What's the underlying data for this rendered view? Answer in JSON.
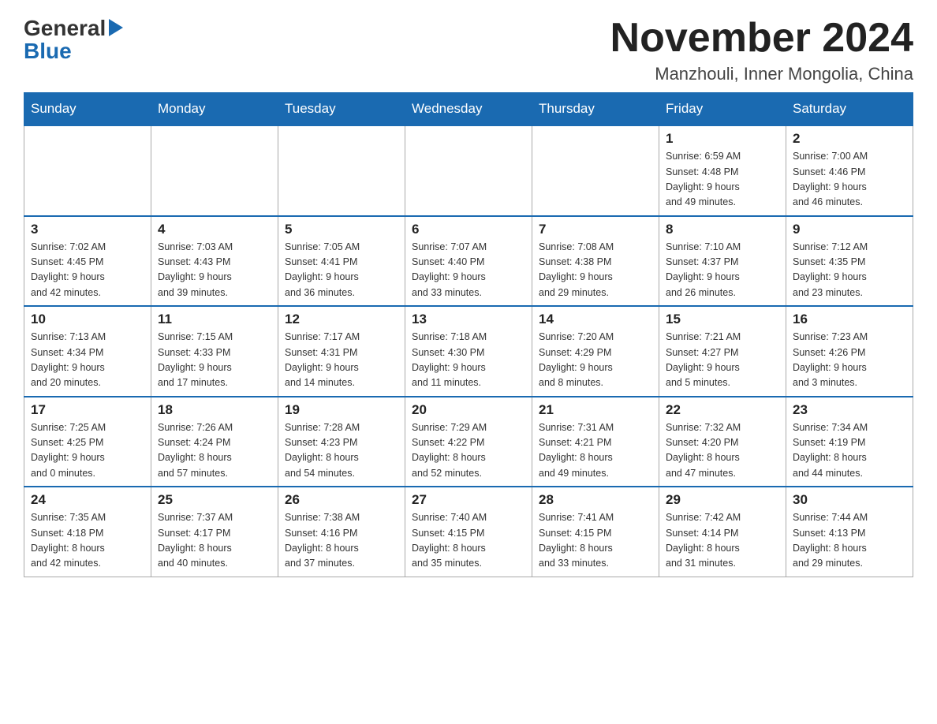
{
  "header": {
    "logo_general": "General",
    "logo_blue": "Blue",
    "month_title": "November 2024",
    "location": "Manzhouli, Inner Mongolia, China"
  },
  "weekdays": [
    "Sunday",
    "Monday",
    "Tuesday",
    "Wednesday",
    "Thursday",
    "Friday",
    "Saturday"
  ],
  "weeks": [
    [
      {
        "day": "",
        "info": ""
      },
      {
        "day": "",
        "info": ""
      },
      {
        "day": "",
        "info": ""
      },
      {
        "day": "",
        "info": ""
      },
      {
        "day": "",
        "info": ""
      },
      {
        "day": "1",
        "info": "Sunrise: 6:59 AM\nSunset: 4:48 PM\nDaylight: 9 hours\nand 49 minutes."
      },
      {
        "day": "2",
        "info": "Sunrise: 7:00 AM\nSunset: 4:46 PM\nDaylight: 9 hours\nand 46 minutes."
      }
    ],
    [
      {
        "day": "3",
        "info": "Sunrise: 7:02 AM\nSunset: 4:45 PM\nDaylight: 9 hours\nand 42 minutes."
      },
      {
        "day": "4",
        "info": "Sunrise: 7:03 AM\nSunset: 4:43 PM\nDaylight: 9 hours\nand 39 minutes."
      },
      {
        "day": "5",
        "info": "Sunrise: 7:05 AM\nSunset: 4:41 PM\nDaylight: 9 hours\nand 36 minutes."
      },
      {
        "day": "6",
        "info": "Sunrise: 7:07 AM\nSunset: 4:40 PM\nDaylight: 9 hours\nand 33 minutes."
      },
      {
        "day": "7",
        "info": "Sunrise: 7:08 AM\nSunset: 4:38 PM\nDaylight: 9 hours\nand 29 minutes."
      },
      {
        "day": "8",
        "info": "Sunrise: 7:10 AM\nSunset: 4:37 PM\nDaylight: 9 hours\nand 26 minutes."
      },
      {
        "day": "9",
        "info": "Sunrise: 7:12 AM\nSunset: 4:35 PM\nDaylight: 9 hours\nand 23 minutes."
      }
    ],
    [
      {
        "day": "10",
        "info": "Sunrise: 7:13 AM\nSunset: 4:34 PM\nDaylight: 9 hours\nand 20 minutes."
      },
      {
        "day": "11",
        "info": "Sunrise: 7:15 AM\nSunset: 4:33 PM\nDaylight: 9 hours\nand 17 minutes."
      },
      {
        "day": "12",
        "info": "Sunrise: 7:17 AM\nSunset: 4:31 PM\nDaylight: 9 hours\nand 14 minutes."
      },
      {
        "day": "13",
        "info": "Sunrise: 7:18 AM\nSunset: 4:30 PM\nDaylight: 9 hours\nand 11 minutes."
      },
      {
        "day": "14",
        "info": "Sunrise: 7:20 AM\nSunset: 4:29 PM\nDaylight: 9 hours\nand 8 minutes."
      },
      {
        "day": "15",
        "info": "Sunrise: 7:21 AM\nSunset: 4:27 PM\nDaylight: 9 hours\nand 5 minutes."
      },
      {
        "day": "16",
        "info": "Sunrise: 7:23 AM\nSunset: 4:26 PM\nDaylight: 9 hours\nand 3 minutes."
      }
    ],
    [
      {
        "day": "17",
        "info": "Sunrise: 7:25 AM\nSunset: 4:25 PM\nDaylight: 9 hours\nand 0 minutes."
      },
      {
        "day": "18",
        "info": "Sunrise: 7:26 AM\nSunset: 4:24 PM\nDaylight: 8 hours\nand 57 minutes."
      },
      {
        "day": "19",
        "info": "Sunrise: 7:28 AM\nSunset: 4:23 PM\nDaylight: 8 hours\nand 54 minutes."
      },
      {
        "day": "20",
        "info": "Sunrise: 7:29 AM\nSunset: 4:22 PM\nDaylight: 8 hours\nand 52 minutes."
      },
      {
        "day": "21",
        "info": "Sunrise: 7:31 AM\nSunset: 4:21 PM\nDaylight: 8 hours\nand 49 minutes."
      },
      {
        "day": "22",
        "info": "Sunrise: 7:32 AM\nSunset: 4:20 PM\nDaylight: 8 hours\nand 47 minutes."
      },
      {
        "day": "23",
        "info": "Sunrise: 7:34 AM\nSunset: 4:19 PM\nDaylight: 8 hours\nand 44 minutes."
      }
    ],
    [
      {
        "day": "24",
        "info": "Sunrise: 7:35 AM\nSunset: 4:18 PM\nDaylight: 8 hours\nand 42 minutes."
      },
      {
        "day": "25",
        "info": "Sunrise: 7:37 AM\nSunset: 4:17 PM\nDaylight: 8 hours\nand 40 minutes."
      },
      {
        "day": "26",
        "info": "Sunrise: 7:38 AM\nSunset: 4:16 PM\nDaylight: 8 hours\nand 37 minutes."
      },
      {
        "day": "27",
        "info": "Sunrise: 7:40 AM\nSunset: 4:15 PM\nDaylight: 8 hours\nand 35 minutes."
      },
      {
        "day": "28",
        "info": "Sunrise: 7:41 AM\nSunset: 4:15 PM\nDaylight: 8 hours\nand 33 minutes."
      },
      {
        "day": "29",
        "info": "Sunrise: 7:42 AM\nSunset: 4:14 PM\nDaylight: 8 hours\nand 31 minutes."
      },
      {
        "day": "30",
        "info": "Sunrise: 7:44 AM\nSunset: 4:13 PM\nDaylight: 8 hours\nand 29 minutes."
      }
    ]
  ]
}
